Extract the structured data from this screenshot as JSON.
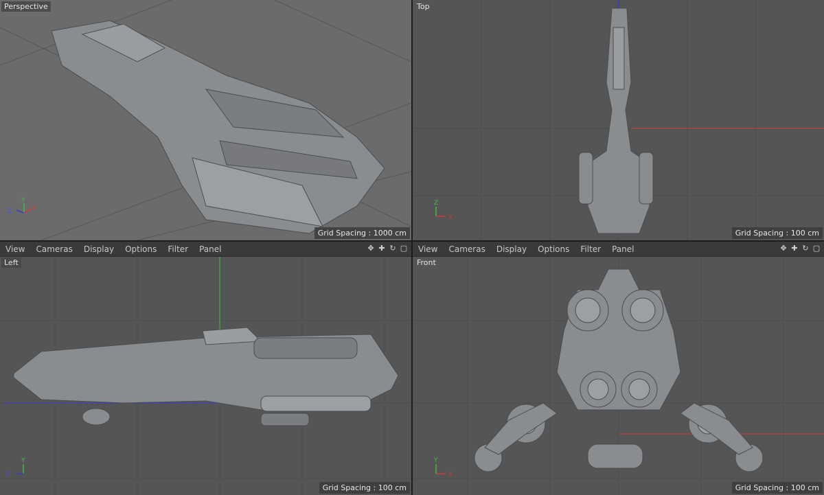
{
  "menu": [
    "View",
    "Cameras",
    "Display",
    "Options",
    "Filter",
    "Panel"
  ],
  "toolbar_icons": [
    "move-icon",
    "drag-icon",
    "rotate-icon",
    "maximize-icon"
  ],
  "viewports": {
    "perspective": {
      "label": "Perspective",
      "grid_spacing": "Grid Spacing : 1000 cm"
    },
    "top": {
      "label": "Top",
      "grid_spacing": "Grid Spacing : 100 cm"
    },
    "left": {
      "label": "Left",
      "grid_spacing": "Grid Spacing : 100 cm"
    },
    "front": {
      "label": "Front",
      "grid_spacing": "Grid Spacing : 100 cm"
    }
  },
  "axes": {
    "x": "X",
    "y": "Y",
    "z": "Z"
  },
  "colors": {
    "x_axis": "#d23a3a",
    "y_axis": "#3fbf3f",
    "z_axis": "#3a3ad2",
    "grid": "#6a6a6a",
    "ship": "#8f9396"
  }
}
